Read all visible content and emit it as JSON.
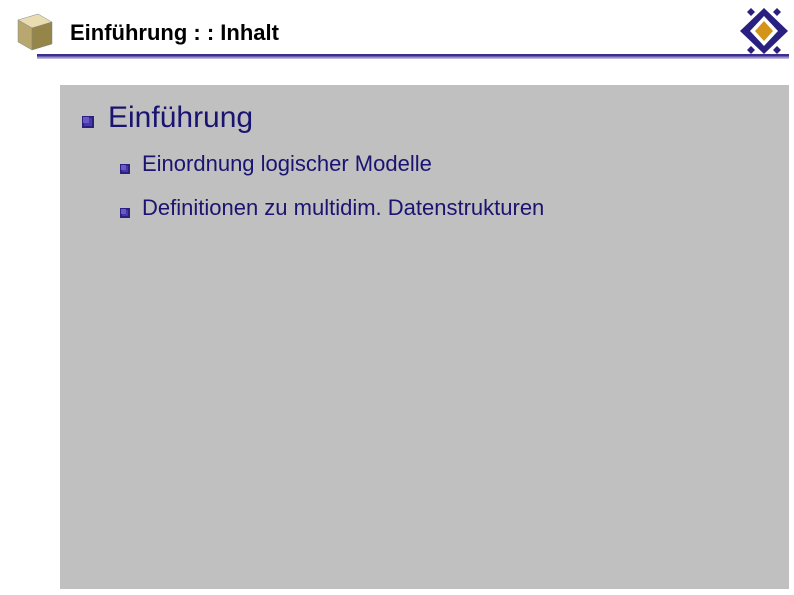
{
  "header": {
    "title": "Einführung : : Inhalt"
  },
  "content": {
    "heading": "Einführung",
    "items": [
      "Einordnung logischer Modelle",
      "Definitionen zu multidim. Datenstrukturen"
    ]
  },
  "colors": {
    "accent": "#3a2e8f",
    "text_heading": "#1a1470",
    "slide_bg": "#c0c0c0"
  }
}
